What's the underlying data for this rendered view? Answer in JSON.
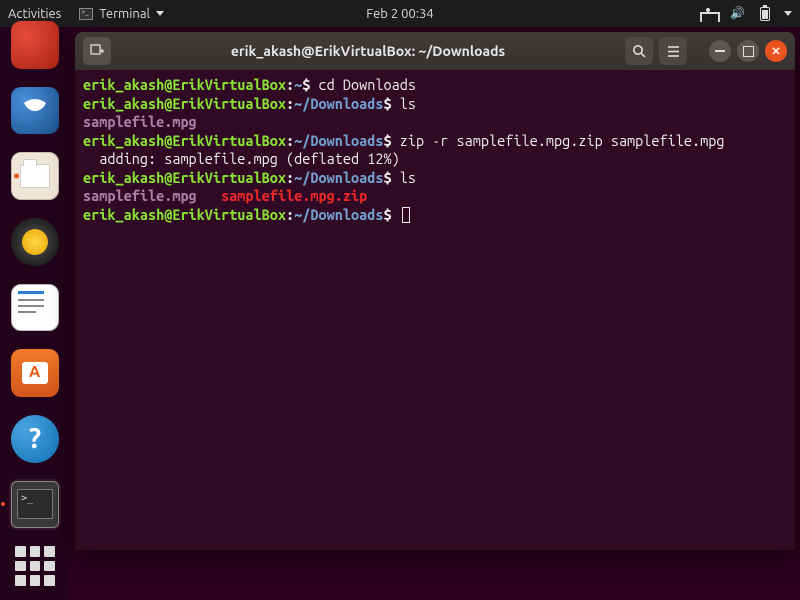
{
  "topbar": {
    "activities": "Activities",
    "app_name": "Terminal",
    "datetime": "Feb 2  00:34"
  },
  "dock": {
    "items": [
      {
        "name": "trash-icon"
      },
      {
        "name": "thunderbird-icon"
      },
      {
        "name": "files-icon"
      },
      {
        "name": "rhythmbox-icon"
      },
      {
        "name": "libreoffice-writer-icon"
      },
      {
        "name": "ubuntu-software-icon"
      },
      {
        "name": "help-icon"
      },
      {
        "name": "terminal-icon"
      }
    ]
  },
  "window": {
    "title": "erik_akash@ErikVirtualBox: ~/Downloads"
  },
  "terminal": {
    "lines": [
      {
        "user": "erik_akash@ErikVirtualBox",
        "path": "~",
        "cmd": "cd Downloads"
      },
      {
        "user": "erik_akash@ErikVirtualBox",
        "path": "~/Downloads",
        "cmd": "ls"
      },
      {
        "out_mpg": "samplefile.mpg"
      },
      {
        "user": "erik_akash@ErikVirtualBox",
        "path": "~/Downloads",
        "cmd": "zip -r samplefile.mpg.zip samplefile.mpg"
      },
      {
        "out": "  adding: samplefile.mpg (deflated 12%)"
      },
      {
        "user": "erik_akash@ErikVirtualBox",
        "path": "~/Downloads",
        "cmd": "ls"
      },
      {
        "out_mpg": "samplefile.mpg",
        "out_zip": "samplefile.mpg.zip"
      },
      {
        "user": "erik_akash@ErikVirtualBox",
        "path": "~/Downloads",
        "cmd": "",
        "cursor": true
      }
    ]
  }
}
